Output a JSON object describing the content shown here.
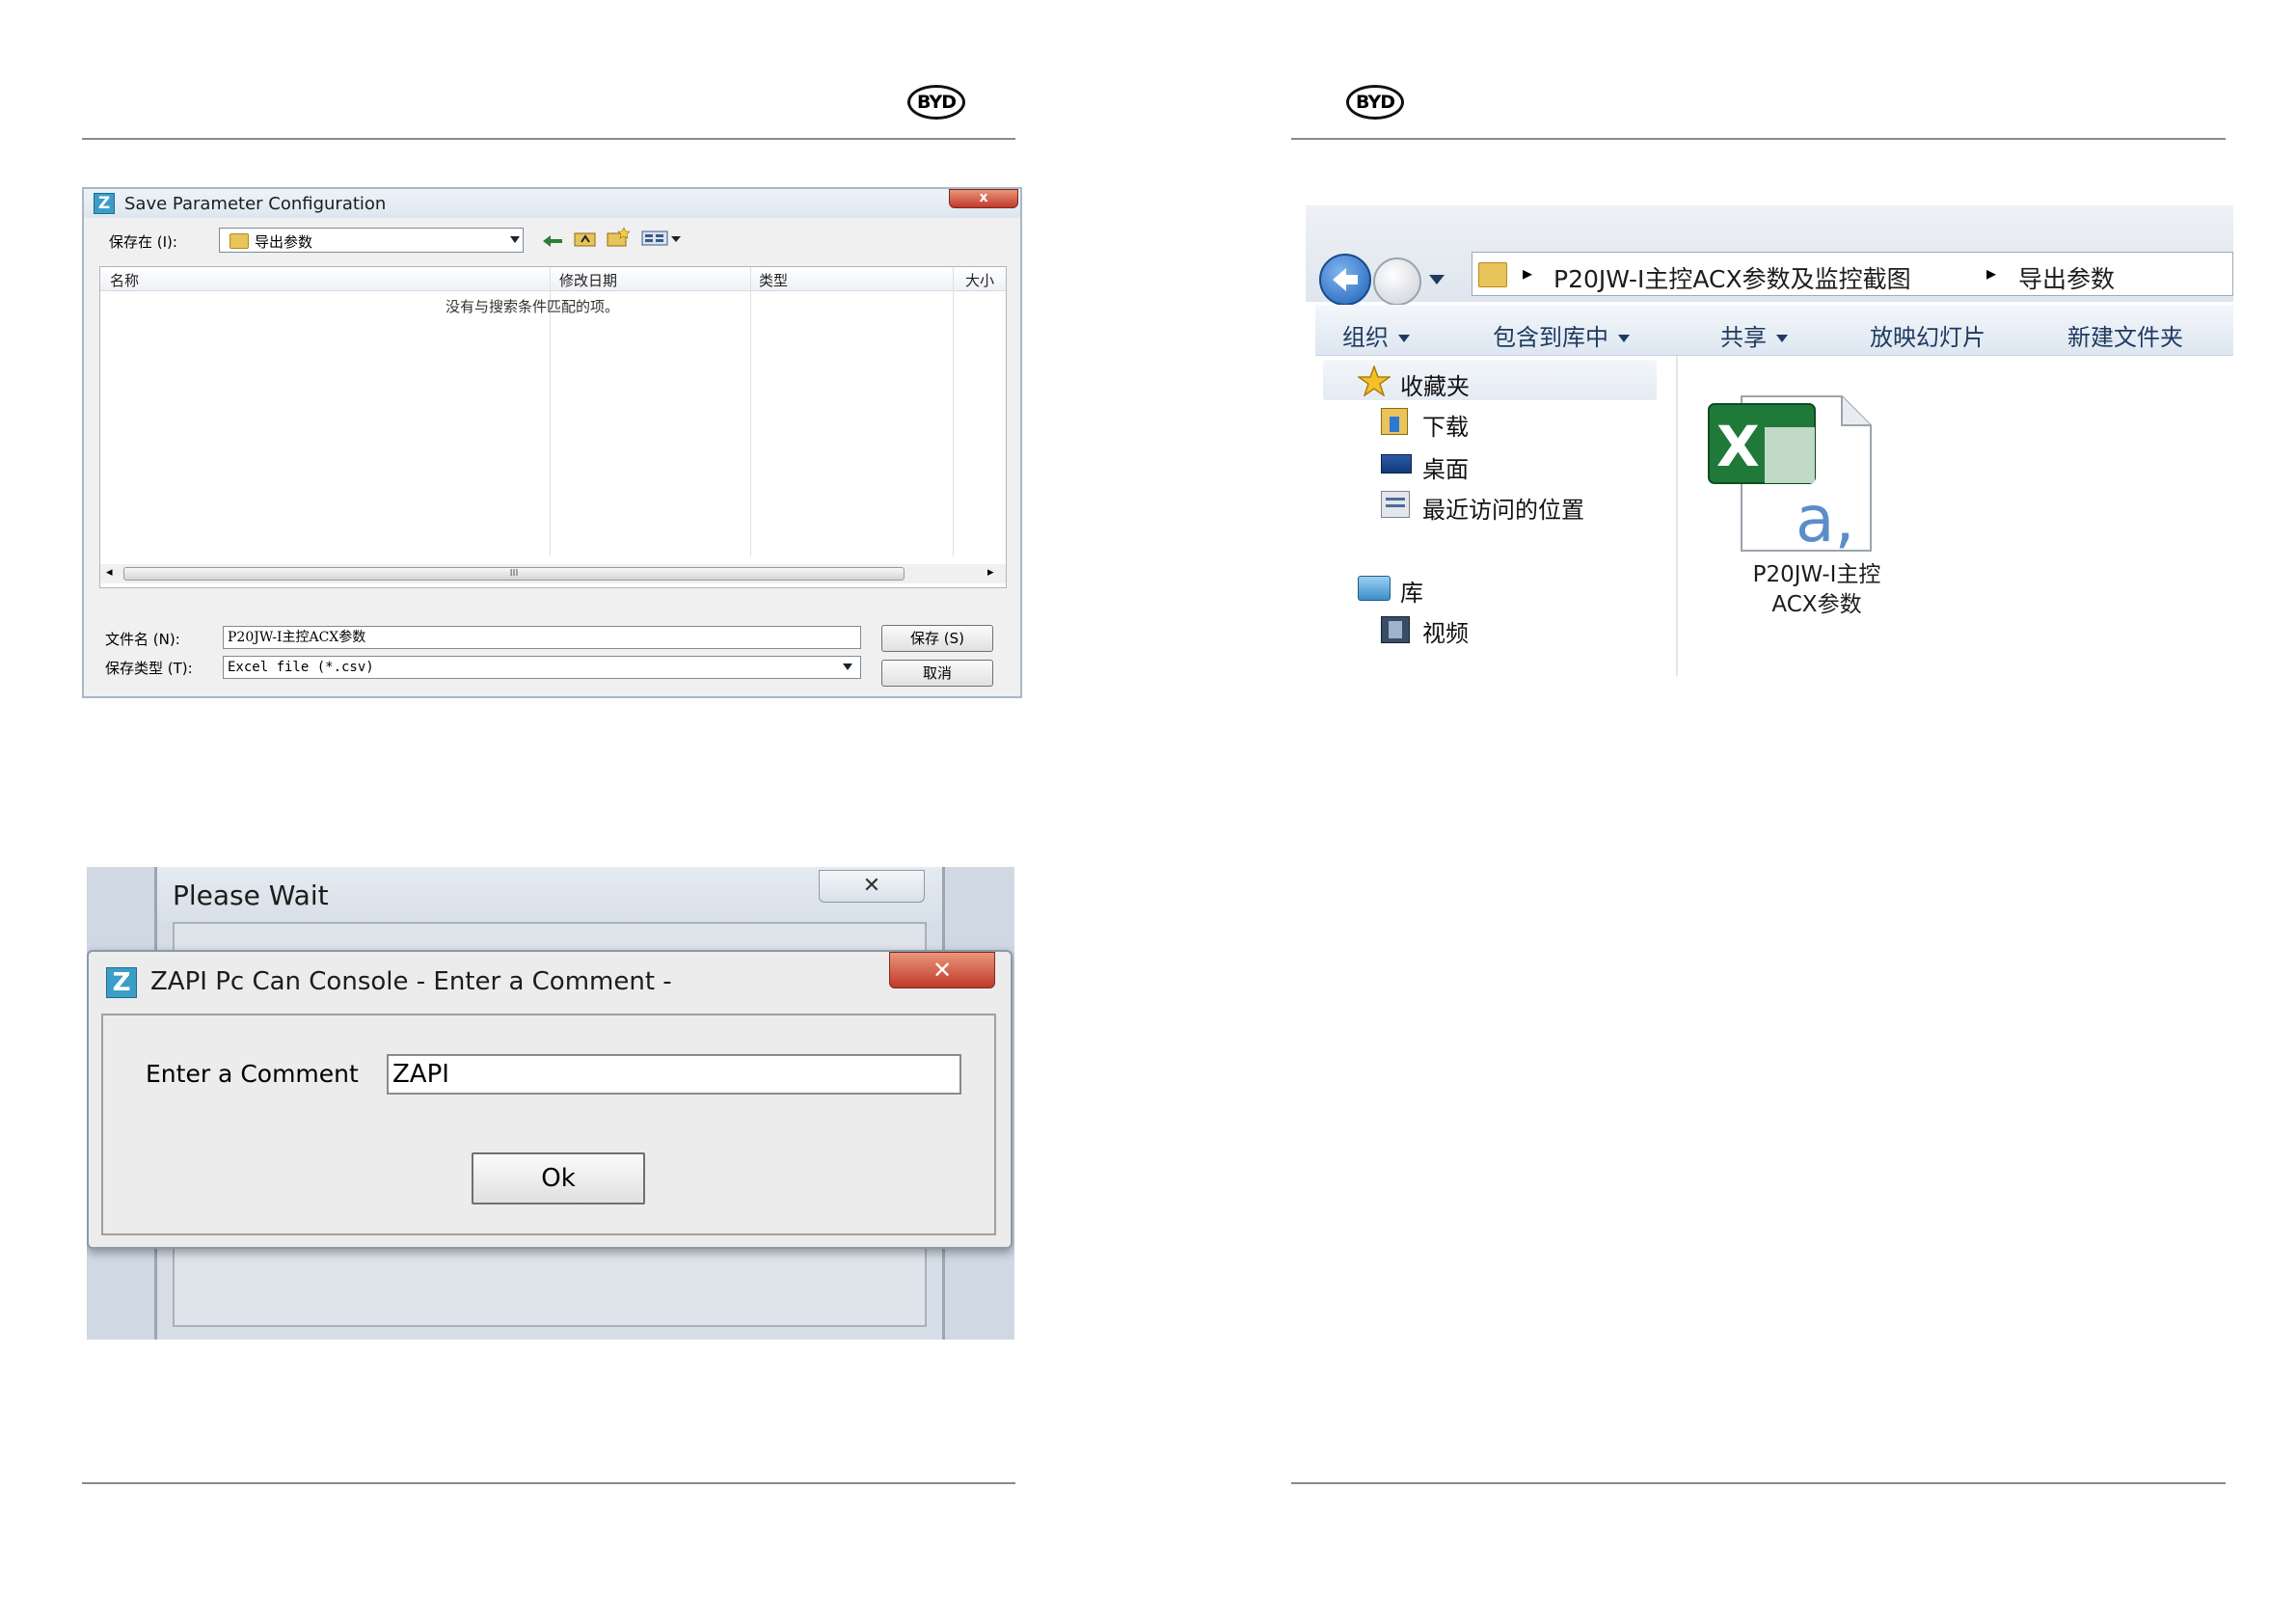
{
  "header": {
    "logo_text": "BYD"
  },
  "save_dialog": {
    "title": "Save Parameter Configuration",
    "close_glyph": "x",
    "save_in_label": "保存在 (I):",
    "save_in_value": "导出参数",
    "columns": [
      "名称",
      "修改日期",
      "类型",
      "大小"
    ],
    "empty_message": "没有与搜索条件匹配的项。",
    "scroll_grip": "III",
    "filename_label": "文件名 (N):",
    "filename_value": "P20JW-I主控ACX参数",
    "filetype_label": "保存类型 (T):",
    "filetype_value": "Excel file (*.csv)",
    "save_button": "保存 (S)",
    "cancel_button": "取消"
  },
  "wait_window": {
    "title": "Please Wait",
    "close_glyph": "✕"
  },
  "comment_dialog": {
    "title": "ZAPI Pc Can Console - Enter a Comment -",
    "close_glyph": "✕",
    "label": "Enter a Comment",
    "input_value": "ZAPI",
    "ok_button": "Ok"
  },
  "explorer": {
    "breadcrumb": [
      "P20JW-I主控ACX参数及监控截图",
      "导出参数"
    ],
    "toolbar": [
      {
        "label": "组织",
        "dropdown": true
      },
      {
        "label": "包含到库中",
        "dropdown": true
      },
      {
        "label": "共享",
        "dropdown": true
      },
      {
        "label": "放映幻灯片",
        "dropdown": false
      },
      {
        "label": "新建文件夹",
        "dropdown": false
      }
    ],
    "nav": {
      "favorites": "收藏夹",
      "downloads": "下载",
      "desktop": "桌面",
      "recent": "最近访问的位置",
      "libraries": "库",
      "videos": "视频"
    },
    "file": {
      "name_line1": "P20JW-I主控",
      "name_line2": "ACX参数",
      "icon_letter": "X",
      "icon_overlay": "a,"
    }
  }
}
